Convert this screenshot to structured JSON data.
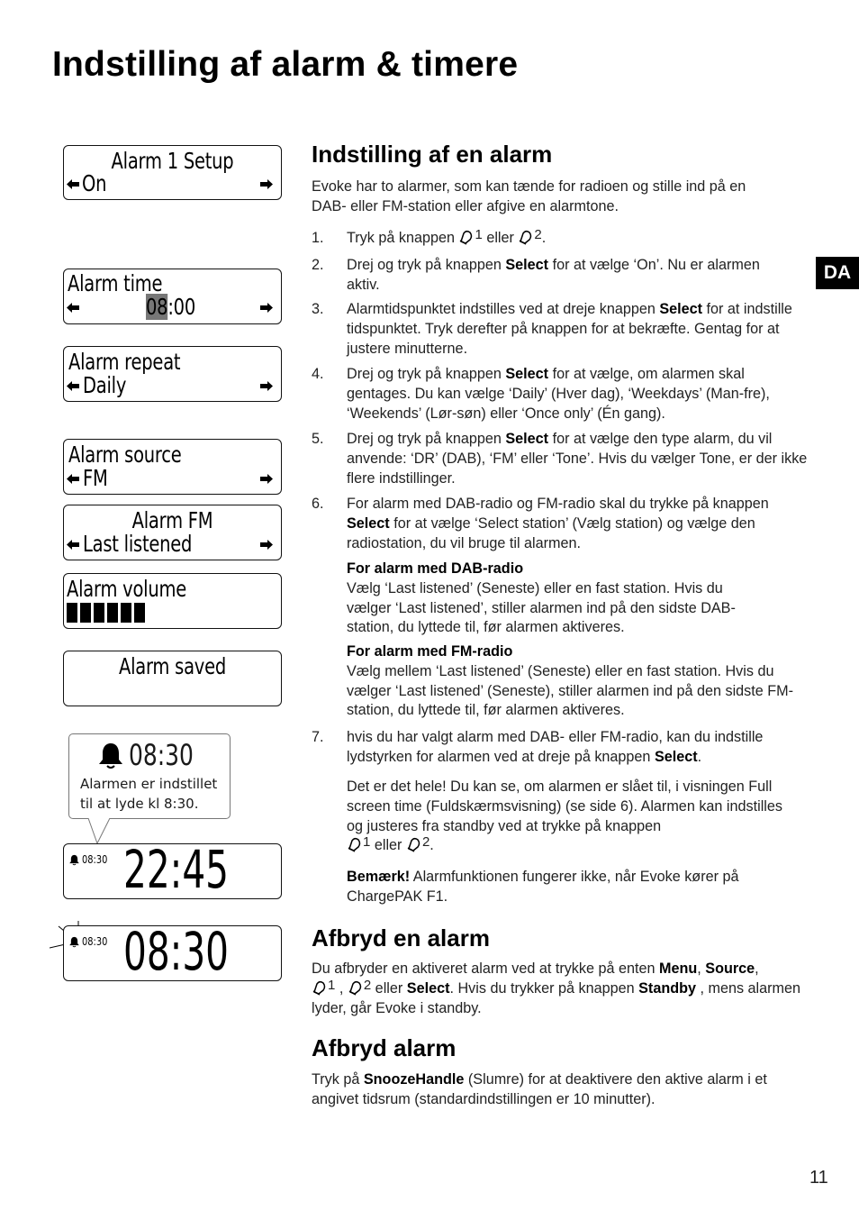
{
  "page": {
    "title": "Indstilling af alarm & timere",
    "language_tab": "DA",
    "page_number": "11"
  },
  "displays": {
    "setup": {
      "title": "Alarm 1 Setup",
      "value": "On"
    },
    "time": {
      "title": "Alarm time",
      "hours": "08",
      "sep_minutes": ":00"
    },
    "repeat": {
      "title": "Alarm repeat",
      "value": "Daily"
    },
    "source": {
      "title": "Alarm source",
      "value": "FM"
    },
    "fm": {
      "title": "Alarm FM",
      "value": "Last listened"
    },
    "volume": {
      "title": "Alarm volume",
      "level_bars": 6
    },
    "saved": {
      "title": "Alarm saved"
    },
    "callout": {
      "time": "08:30",
      "text_line1": "Alarmen er indstillet",
      "text_line2": "til at lyde kl 8:30."
    },
    "clock_standby": {
      "alarm_time": "08:30",
      "clock": "22:45"
    },
    "clock_ringing": {
      "alarm_time": "08:30",
      "clock": "08:30"
    }
  },
  "section_setup": {
    "heading": "Indstilling af en alarm",
    "intro_line1": "Evoke har to alarmer, som kan tænde for radioen og stille ind på en",
    "intro_line2": "DAB- eller FM-station eller afgive en alarmtone.",
    "steps": [
      {
        "num": "1.",
        "pre": "Tryk på knappen ",
        "b1": "1",
        "mid": " eller ",
        "b2": "2",
        "post": "."
      },
      {
        "num": "2.",
        "pre": "Drej og tryk på knappen ",
        "bold": "Select",
        "post": " for at vælge ‘On’. Nu er alarmen aktiv."
      },
      {
        "num": "3.",
        "pre": "Alarmtidspunktet indstilles ved at dreje knappen ",
        "bold": "Select",
        "post": " for at indstille tidspunktet. Tryk derefter på knappen for at bekræfte. Gentag for at justere minutterne."
      },
      {
        "num": "4.",
        "pre": "Drej og tryk på knappen ",
        "bold": "Select",
        "post": " for at vælge, om alarmen skal gentages. Du kan vælge ‘Daily’ (Hver dag), ‘Weekdays’ (Man-fre), ‘Weekends’ (Lør-søn) eller ‘Once only’ (Én gang)."
      },
      {
        "num": "5.",
        "pre": "Drej og tryk på knappen ",
        "bold": "Select",
        "post": " for at vælge den type alarm, du vil anvende: ‘DR’ (DAB), ‘FM’ eller ‘Tone’. Hvis du vælger Tone, er der ikke flere indstillinger."
      },
      {
        "num": "6.",
        "pre": "For alarm med DAB-radio og FM-radio skal du trykke på knappen ",
        "bold": "Select",
        "post": " for at vælge ‘Select station’ (Vælg station) og vælge den radiostation, du vil bruge til alarmen."
      },
      {
        "num": "7.",
        "pre": "hvis du har valgt alarm med DAB- eller FM-radio, kan du indstille lydstyrken for alarmen ved at dreje på knappen ",
        "bold": "Select",
        "post": "."
      }
    ],
    "dab": {
      "heading": "For alarm med DAB-radio",
      "text": "Vælg ‘Last listened’ (Seneste) eller en fast station. Hvis du vælger ‘Last listened’, stiller alarmen ind på den sidste DAB-station, du lyttede til, før alarmen aktiveres."
    },
    "fm": {
      "heading": "For alarm med FM-radio",
      "text": "Vælg mellem ‘Last listened’ (Seneste) eller en fast station. Hvis du vælger ‘Last listened’ (Seneste), stiller alarmen ind på den sidste FM-station, du lyttede til, før alarmen aktiveres."
    },
    "done": {
      "text": "Det er det hele! Du kan se, om alarmen er slået til, i visningen Full screen time (Fuldskærmsvisning) (se side 6). Alarmen kan indstilles og justeres fra standby ved at trykke på knappen",
      "b1": "1",
      "mid": " eller ",
      "b2": "2",
      "post": "."
    },
    "note": {
      "bold": "Bemærk!",
      "text": " Alarmfunktionen fungerer ikke, når Evoke kører på ChargePAK F1."
    }
  },
  "section_cancel": {
    "heading": "Afbryd en alarm",
    "pre": "Du afbryder en aktiveret alarm ved at trykke på enten ",
    "bold1": "Menu",
    "sep1": ", ",
    "bold2": "Source",
    "sep2": ",",
    "b1": "1",
    "sep3": " , ",
    "b2": "2",
    "mid": " eller ",
    "bold3": "Select",
    "mid2": ". Hvis du trykker på knappen ",
    "bold4": "Standby",
    "post": " , mens alarmen lyder, går Evoke i standby."
  },
  "section_snooze": {
    "heading": "Afbryd alarm",
    "pre": "Tryk på ",
    "bold": "SnoozeHandle",
    "post": " (Slumre) for at deaktivere den aktive alarm i et angivet tidsrum (standardindstillingen er 10 minutter)."
  }
}
